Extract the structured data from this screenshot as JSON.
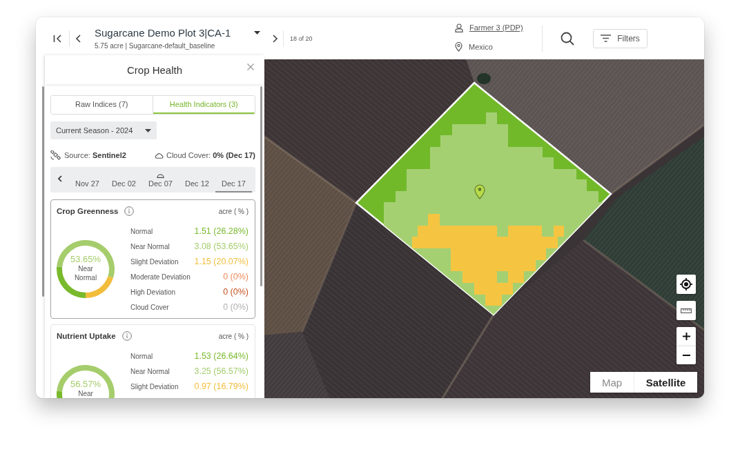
{
  "header": {
    "plot": {
      "title": "Sugarcane Demo Plot 3|CA-1",
      "subtitle": "5.75 acre | Sugarcane-default_baseline"
    },
    "counter": "18 of 20",
    "farmer": {
      "name": "Farmer 3 (PDP)",
      "location": "Mexico"
    },
    "filters_button": "Filters"
  },
  "panel": {
    "title": "Crop Health",
    "tabs": [
      {
        "label": "Raw Indices (7)",
        "selected": false
      },
      {
        "label": "Health Indicators (3)",
        "selected": true
      }
    ],
    "season": "Current Season - 2024",
    "source": "Source: **Sentinel2**",
    "cloud_cover": "Cloud Cover: **0% (Dec 17)**",
    "dates": [
      {
        "label": "Nov 27",
        "cloudy": false,
        "selected": false
      },
      {
        "label": "Dec 02",
        "cloudy": false,
        "selected": false
      },
      {
        "label": "Dec 07",
        "cloudy": true,
        "selected": false
      },
      {
        "label": "Dec 12",
        "cloudy": false,
        "selected": false
      },
      {
        "label": "Dec 17",
        "cloudy": false,
        "selected": true
      }
    ],
    "cards": [
      {
        "title": "Crop Greenness",
        "unit": "acre ( % )",
        "selected": true,
        "center_value": "53.65%",
        "center_label": "Near Normal",
        "chart_data": {
          "type": "donut",
          "values": [
            26.28,
            53.65,
            20.07,
            0,
            0,
            0
          ]
        },
        "rows": [
          {
            "label": "Normal",
            "value": "1.51 (26.28%)",
            "color": "#79b92c"
          },
          {
            "label": "Near Normal",
            "value": "3.08 (53.65%)",
            "color": "#a5cd6c"
          },
          {
            "label": "Slight Deviation",
            "value": "1.15 (20.07%)",
            "color": "#f3bd3c"
          },
          {
            "label": "Moderate Deviation",
            "value": "0 (0%)",
            "color": "#f08a58"
          },
          {
            "label": "High Deviation",
            "value": "0 (0%)",
            "color": "#c6501d"
          },
          {
            "label": "Cloud Cover",
            "value": "0 (0%)",
            "color": "#b0b0b0"
          }
        ]
      },
      {
        "title": "Nutrient Uptake",
        "unit": "acre ( % )",
        "selected": false,
        "center_value": "56.57%",
        "center_label": "Near",
        "rows": [
          {
            "label": "Normal",
            "value": "1.53 (26.64%)",
            "color": "#79b92c"
          },
          {
            "label": "Near Normal",
            "value": "3.25 (56.57%)",
            "color": "#a5cd6c"
          },
          {
            "label": "Slight Deviation",
            "value": "0.97 (16.79%)",
            "color": "#f3bd3c"
          }
        ]
      }
    ]
  },
  "map": {
    "map_types": [
      {
        "label": "Map",
        "selected": false
      },
      {
        "label": "Satellite",
        "selected": true
      }
    ]
  }
}
